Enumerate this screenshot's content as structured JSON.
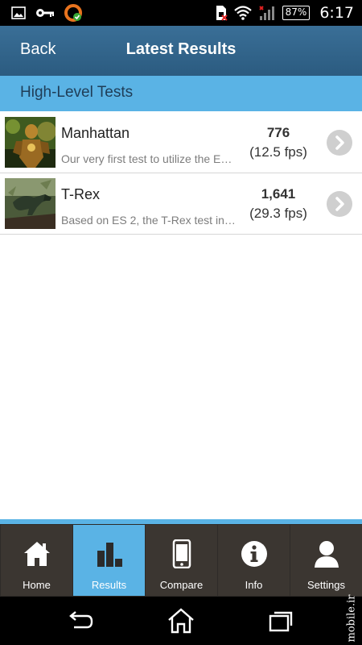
{
  "status_bar": {
    "battery_percent": "87%",
    "time": "6:17",
    "icons": [
      "gallery-icon",
      "key-icon",
      "app-notification-icon",
      "sim-error-icon",
      "wifi-icon",
      "signal-icon",
      "battery-icon"
    ]
  },
  "app_bar": {
    "back_label": "Back",
    "title": "Latest Results"
  },
  "section": {
    "title": "High-Level Tests"
  },
  "results": [
    {
      "name": "Manhattan",
      "description": "Our very first test to utilize the E…",
      "score": "776",
      "fps": "(12.5 fps)",
      "icon": "manhattan-thumbnail"
    },
    {
      "name": "T-Rex",
      "description": "Based on ES 2, the T-Rex test in…",
      "score": "1,641",
      "fps": "(29.3 fps)",
      "icon": "t-rex-thumbnail"
    }
  ],
  "tabs": [
    {
      "label": "Home",
      "icon": "home-icon",
      "active": false
    },
    {
      "label": "Results",
      "icon": "bar-chart-icon",
      "active": true
    },
    {
      "label": "Compare",
      "icon": "phone-icon",
      "active": false
    },
    {
      "label": "Info",
      "icon": "info-icon",
      "active": false
    },
    {
      "label": "Settings",
      "icon": "user-icon",
      "active": false
    }
  ],
  "nav_bar": {
    "icons": [
      "back-nav-icon",
      "home-nav-icon",
      "recent-apps-icon"
    ]
  },
  "watermark": "mobile.ir",
  "colors": {
    "app_bar": "#2b5b80",
    "accent": "#5ab3e5",
    "tab_bar": "#3b3631"
  }
}
